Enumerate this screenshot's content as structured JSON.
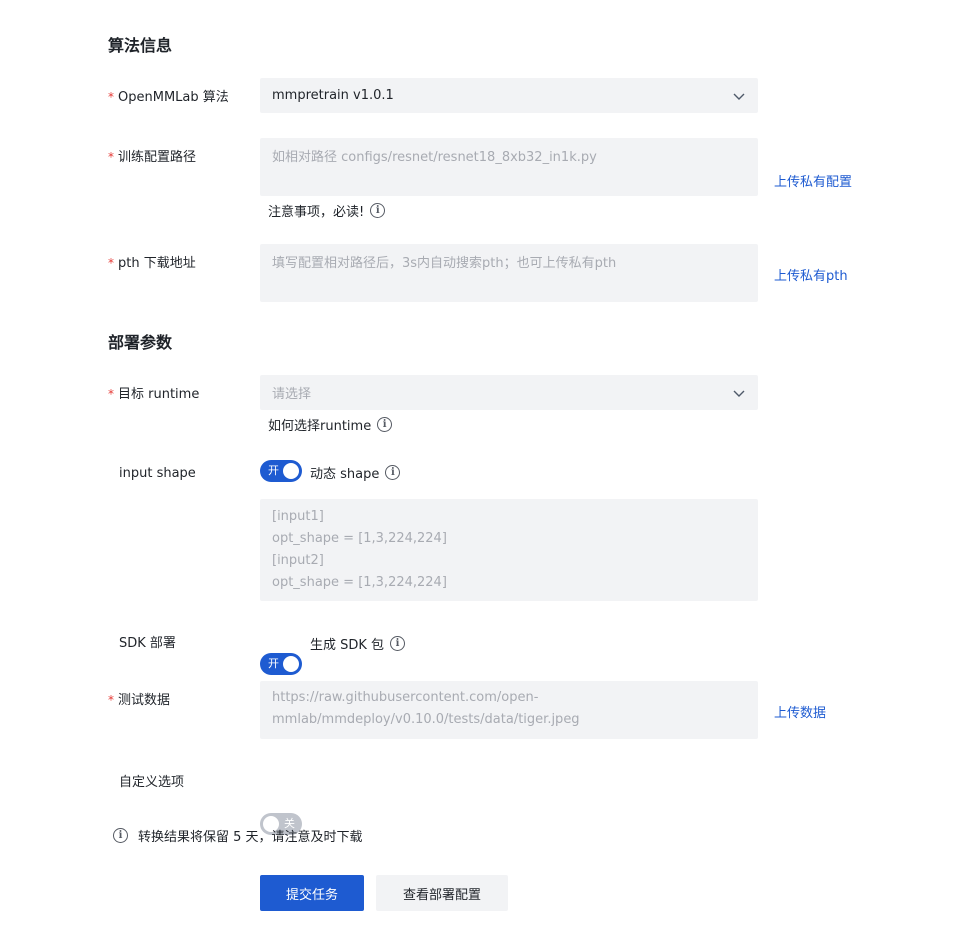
{
  "algo_section": {
    "title": "算法信息"
  },
  "algorithm": {
    "label": "OpenMMLab 算法",
    "value": "mmpretrain v1.0.1"
  },
  "train_config": {
    "label": "训练配置路径",
    "placeholder": "如相对路径 configs/resnet/resnet18_8xb32_in1k.py",
    "note": "注意事项，必读!",
    "upload_link": "上传私有配置"
  },
  "pth": {
    "label": "pth 下载地址",
    "placeholder": "填写配置相对路径后，3s内自动搜索pth；也可上传私有pth",
    "upload_link": "上传私有pth"
  },
  "deploy_section": {
    "title": "部署参数"
  },
  "runtime": {
    "label": "目标 runtime",
    "placeholder": "请选择",
    "help": "如何选择runtime"
  },
  "input_shape": {
    "label": "input shape",
    "switch_text": "开",
    "switch_label": "动态 shape",
    "placeholder_lines": [
      "[input1]",
      "opt_shape = [1,3,224,224]",
      "[input2]",
      "opt_shape = [1,3,224,224]"
    ]
  },
  "sdk": {
    "label": "SDK 部署",
    "switch_text": "开",
    "switch_label": "生成 SDK 包"
  },
  "test_data": {
    "label": "测试数据",
    "placeholder_lines": [
      "https://raw.githubusercontent.com/open-",
      "mmlab/mmdeploy/v0.10.0/tests/data/tiger.jpeg"
    ],
    "upload_link": "上传数据"
  },
  "custom_options": {
    "label": "自定义选项",
    "switch_text": "关"
  },
  "retention_note": "转换结果将保留 5 天，请注意及时下载",
  "actions": {
    "submit": "提交任务",
    "view_config": "查看部署配置"
  },
  "required_mark": "*",
  "info_glyph": "i",
  "colors": {
    "primary": "#1e5bd1",
    "field_bg": "#f2f3f5",
    "required": "#e53935",
    "placeholder": "#a8abb2"
  }
}
